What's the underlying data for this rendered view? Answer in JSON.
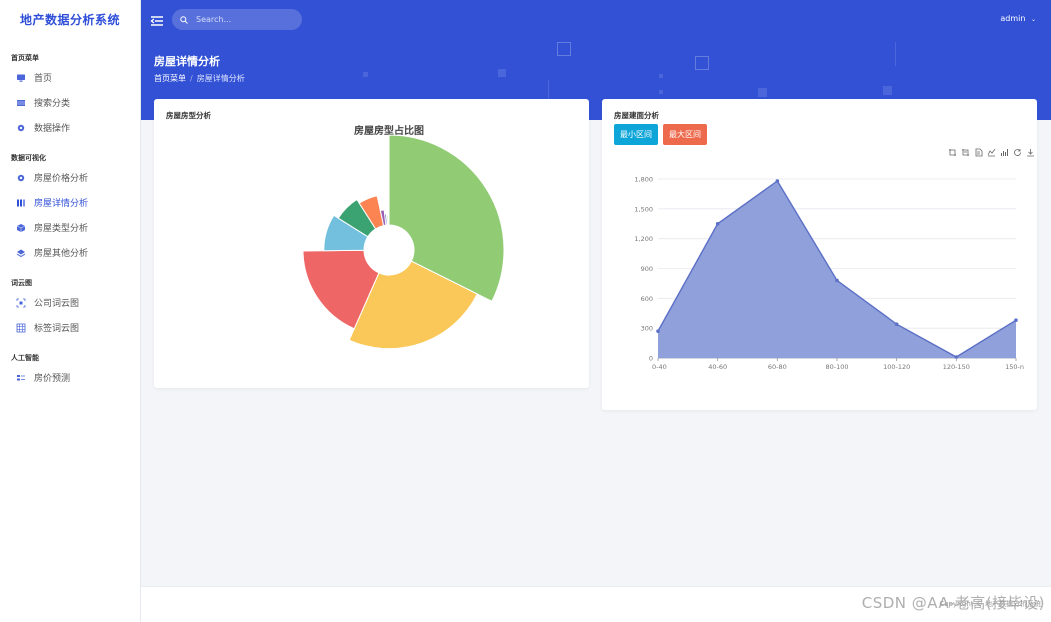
{
  "app": {
    "brand": "地产数据分析系统"
  },
  "sidebar": {
    "groups": [
      {
        "title": "首页菜单",
        "items": [
          {
            "label": "首页",
            "icon": "monitor-icon"
          },
          {
            "label": "搜索分类",
            "icon": "table-icon"
          },
          {
            "label": "数据操作",
            "icon": "gear-icon"
          }
        ]
      },
      {
        "title": "数据可视化",
        "items": [
          {
            "label": "房屋价格分析",
            "icon": "gear-icon"
          },
          {
            "label": "房屋详情分析",
            "icon": "columns-icon",
            "active": true
          },
          {
            "label": "房屋类型分析",
            "icon": "cube-icon"
          },
          {
            "label": "房屋其他分析",
            "icon": "layers-icon"
          }
        ]
      },
      {
        "title": "词云图",
        "items": [
          {
            "label": "公司词云图",
            "icon": "grid-dots-icon"
          },
          {
            "label": "标签词云图",
            "icon": "grid-icon"
          }
        ]
      },
      {
        "title": "人工智能",
        "items": [
          {
            "label": "房价预测",
            "icon": "list-icon"
          }
        ]
      }
    ]
  },
  "header": {
    "search_placeholder": "Search...",
    "user": "admin",
    "page_title": "房屋详情分析",
    "breadcrumb": [
      "首页菜单",
      "房屋详情分析"
    ]
  },
  "left_card": {
    "title": "房屋房型分析"
  },
  "right_card": {
    "title": "房屋建面分析",
    "btn_min": "最小区间",
    "btn_max": "最大区间"
  },
  "colors": {
    "primary": "#3251d5",
    "btn_min": "#0ea5d8",
    "btn_max": "#ee6a4d",
    "area_fill": "#8a9bd8",
    "area_line": "#5b70c6"
  },
  "toolbox_icons": [
    "zoom-in-icon",
    "zoom-reset-icon",
    "data-view-icon",
    "line-icon",
    "bar-icon",
    "restore-icon",
    "download-icon"
  ],
  "footer": {
    "text": "Copyright © 地产数据分析系统"
  },
  "watermark": "CSDN @AA-老高(接毕设)",
  "chart_data": [
    {
      "type": "pie",
      "title": "房屋房型占比图",
      "donut": true,
      "rose": true,
      "slices": [
        {
          "value": 32,
          "color": "#91cc75"
        },
        {
          "value": 24,
          "color": "#fac858"
        },
        {
          "value": 18,
          "color": "#ee6666"
        },
        {
          "value": 9,
          "color": "#73c0de"
        },
        {
          "value": 7,
          "color": "#3ba272"
        },
        {
          "value": 5.5,
          "color": "#fc8452"
        },
        {
          "value": 1.5,
          "color": "#9a60b4"
        },
        {
          "value": 0.8,
          "color": "#5470c6"
        },
        {
          "value": 0.6,
          "color": "#91cc75"
        },
        {
          "value": 0.5,
          "color": "#fac858"
        }
      ]
    },
    {
      "type": "area",
      "categories": [
        "0-40",
        "40-60",
        "60-80",
        "80-100",
        "100-120",
        "120-150",
        "150-n"
      ],
      "values": [
        270,
        1350,
        1780,
        780,
        340,
        10,
        380
      ],
      "ylim": [
        0,
        1800
      ],
      "yticks": [
        "0",
        "300",
        "600",
        "900",
        "1,200",
        "1,500",
        "1,800"
      ],
      "grid": true
    }
  ]
}
